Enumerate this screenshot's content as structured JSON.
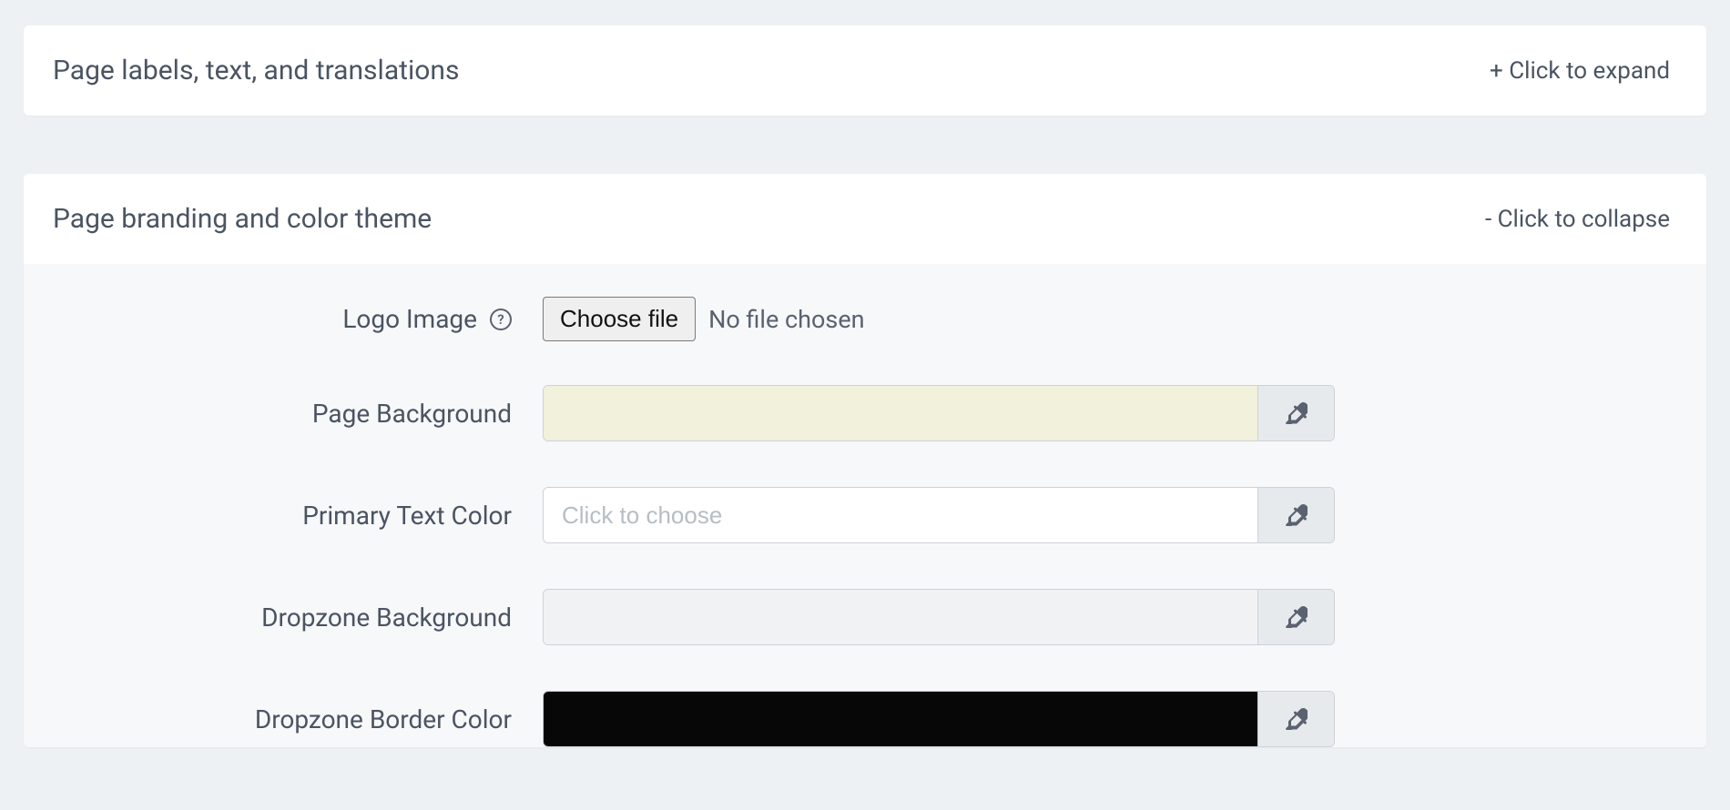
{
  "panels": {
    "labels": {
      "title": "Page labels, text, and translations",
      "toggle": "+ Click to expand"
    },
    "branding": {
      "title": "Page branding and color theme",
      "toggle": "- Click to collapse"
    }
  },
  "form": {
    "logo": {
      "label": "Logo Image",
      "help": "?",
      "button": "Choose file",
      "status": "No file chosen"
    },
    "page_background": {
      "label": "Page Background",
      "color": "#f1f1dc",
      "placeholder": ""
    },
    "primary_text_color": {
      "label": "Primary Text Color",
      "color": "#ffffff",
      "placeholder": "Click to choose"
    },
    "dropzone_background": {
      "label": "Dropzone Background",
      "color": "#f1f2f3",
      "placeholder": ""
    },
    "dropzone_border_color": {
      "label": "Dropzone Border Color",
      "color": "#070707",
      "placeholder": ""
    }
  }
}
